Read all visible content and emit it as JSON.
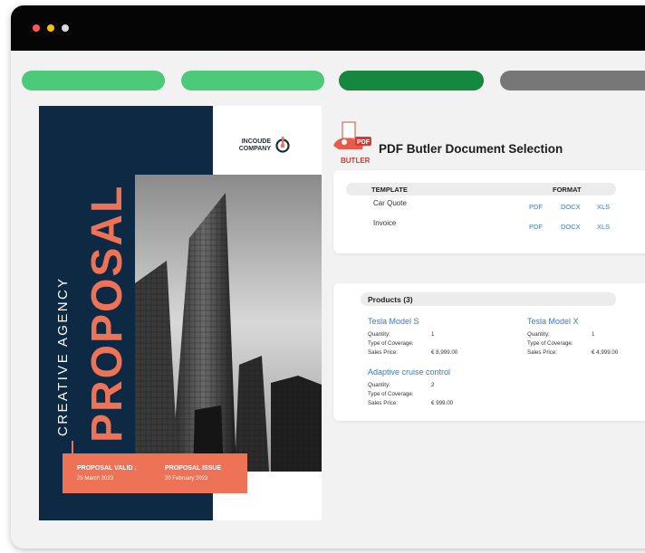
{
  "cover": {
    "company_line1": "INCOUDE",
    "company_line2": "COMPANY",
    "agency": "CREATIVE AGENCY",
    "title": "PROPOSAL",
    "valid_label": "PROPOSAL VALID :",
    "valid_date": "25 March 2023",
    "issue_label": "PROPOSAL ISSUE",
    "issue_date": "20 February 2023"
  },
  "panel": {
    "logo_text": "BUTLER",
    "logo_badge": "PDF",
    "title": "PDF Butler Document Selection"
  },
  "templates": {
    "col_template": "TEMPLATE",
    "col_format": "FORMAT",
    "rows": [
      {
        "name": "Car Quote",
        "formats": [
          "PDF",
          "DOCX",
          "XLS"
        ]
      },
      {
        "name": "Invoice",
        "formats": [
          "PDF",
          "DOCX",
          "XLS"
        ]
      }
    ]
  },
  "products": {
    "heading": "Products (3)",
    "items": [
      {
        "name": "Tesla Model S",
        "quantity_label": "Quantity:",
        "quantity": "1",
        "coverage_label": "Type of Coverage:",
        "price_label": "Sales Price:",
        "price": "€ 8,999.00"
      },
      {
        "name": "Tesla Model X",
        "quantity_label": "Quantity:",
        "quantity": "1",
        "coverage_label": "Type of Coverage:",
        "price_label": "Sales Price:",
        "price": "€ 4,999.00"
      },
      {
        "name": "Adaptive cruise control",
        "quantity_label": "Quantity:",
        "quantity": "2",
        "coverage_label": "Type of Coverage:",
        "price_label": "Sales Price:",
        "price": "€ 999.00"
      }
    ]
  },
  "colors": {
    "step_done": "#4cca7a",
    "step_active": "#16873f",
    "step_todo": "#777777",
    "accent": "#ee7356",
    "navy": "#0d2944",
    "link": "#2f7bd8"
  }
}
